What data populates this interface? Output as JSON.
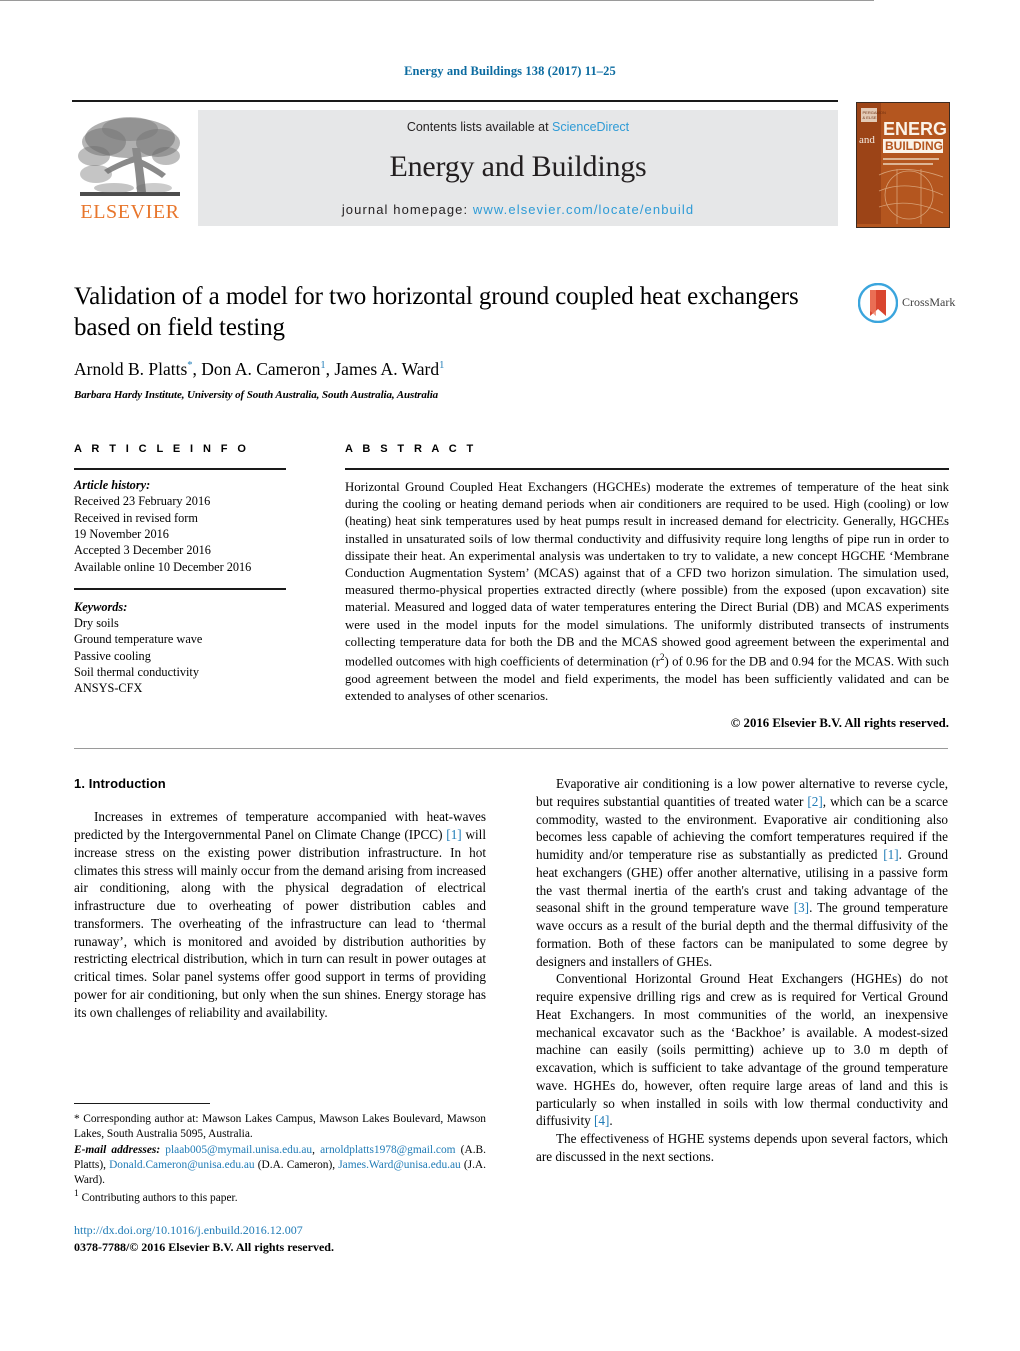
{
  "running_head": "Energy and Buildings 138 (2017) 11–25",
  "masthead": {
    "contents_prefix": "Contents lists available at ",
    "sciencedirect": "ScienceDirect",
    "journal_title": "Energy and Buildings",
    "homepage_prefix": "journal homepage: ",
    "homepage_url": "www.elsevier.com/locate/enbuild",
    "publisher": "ELSEVIER",
    "cover_and": "and",
    "cover_energy": "ENERGY",
    "cover_buildings": "BUILDINGS",
    "link_color": "#2e9bd6",
    "band_color": "#e6e7e8"
  },
  "crossmark": {
    "label": "CrossMark"
  },
  "title": "Validation of a model for two horizontal ground coupled heat exchangers based on field testing",
  "authors_html": "Arnold B. Platts<sup>*</sup>, Don A. Cameron<sup>1</sup>, James A. Ward<sup>1</sup>",
  "affiliation": "Barbara Hardy Institute, University of South Australia, South Australia, Australia",
  "article_info": {
    "heading": "A R T I C L E   I N F O",
    "history_label": "Article history:",
    "history": [
      "Received 23 February 2016",
      "Received in revised form",
      "19 November 2016",
      "Accepted 3 December 2016",
      "Available online 10 December 2016"
    ],
    "keywords_label": "Keywords:",
    "keywords": [
      "Dry soils",
      "Ground temperature wave",
      "Passive cooling",
      "Soil thermal conductivity",
      "ANSYS-CFX"
    ]
  },
  "abstract": {
    "heading": "A B S T R A C T",
    "text_html": "Horizontal Ground Coupled Heat Exchangers (HGCHEs) moderate the extremes of temperature of the heat sink during the cooling or heating demand periods when air conditioners are required to be used. High (cooling) or low (heating) heat sink temperatures used by heat pumps result in increased demand for electricity. Generally, HGCHEs installed in unsaturated soils of low thermal conductivity and diffusivity require long lengths of pipe run in order to dissipate their heat. An experimental analysis was undertaken to try to validate, a new concept HGCHE ‘Membrane Conduction Augmentation System’ (MCAS) against that of a CFD two horizon simulation. The simulation used, measured thermo-physical properties extracted directly (where possible) from the exposed (upon excavation) site material. Measured and logged data of water temperatures entering the Direct Burial (DB) and MCAS experiments were used in the model inputs for the model simulations. The uniformly distributed transects of instruments collecting temperature data for both the DB and the MCAS showed good agreement between the experimental and modelled outcomes with high coefficients of determination (r<sup>2</sup>) of 0.96 for the DB and 0.94 for the MCAS. With such good agreement between the model and field experiments, the model has been sufficiently validated and can be extended to analyses of other scenarios.",
    "copyright": "© 2016 Elsevier B.V. All rights reserved."
  },
  "body": {
    "section_number_title": "1.  Introduction",
    "left_paragraphs_html": [
      "Increases in extremes of temperature accompanied with heat-waves predicted by the Intergovernmental Panel on Climate Change (IPCC) <span class=\"ref\">[1]</span> will increase stress on the existing power distribution infrastructure. In hot climates this stress will mainly occur from the demand arising from increased air conditioning, along with the physical degradation of electrical infrastructure due to overheating of power distribution cables and transformers. The overheating of the infrastructure can lead to ‘thermal runaway’, which is monitored and avoided by distribution authorities by restricting electrical distribution, which in turn can result in power outages at critical times. Solar panel systems offer good support in terms of providing power for air conditioning, but only when the sun shines. Energy storage has its own challenges of reliability and availability."
    ],
    "right_paragraphs_html": [
      "Evaporative air conditioning is a low power alternative to reverse cycle, but requires substantial quantities of treated water <span class=\"ref\">[2]</span>, which can be a scarce commodity, wasted to the environment. Evaporative air conditioning also becomes less capable of achieving the comfort temperatures required if the humidity and/or temperature rise as substantially as predicted <span class=\"ref\">[1]</span>. Ground heat exchangers (GHE) offer another alternative, utilising in a passive form the vast thermal inertia of the earth's crust and taking advantage of the seasonal shift in the ground temperature wave <span class=\"ref\">[3]</span>. The ground temperature wave occurs as a result of the burial depth and the thermal diffusivity of the formation. Both of these factors can be manipulated to some degree by designers and installers of GHEs.",
      "Conventional Horizontal Ground Heat Exchangers (HGHEs) do not require expensive drilling rigs and crew as is required for Vertical Ground Heat Exchangers. In most communities of the world, an inexpensive mechanical excavator such as the ‘Backhoe’ is available. A modest-sized machine can easily (soils permitting) achieve up to 3.0 m depth of excavation, which is sufficient to take advantage of the ground temperature wave. HGHEs do, however, often require large areas of land and this is particularly so when installed in soils with low thermal conductivity and diffusivity <span class=\"ref\">[4]</span>.",
      "The effectiveness of HGHE systems depends upon several factors, which are discussed in the next sections."
    ]
  },
  "footnotes": {
    "corresponding_html": "<span>*</span>  Corresponding author at: Mawson Lakes Campus, Mawson Lakes Boulevard, Mawson Lakes, South Australia 5095, Australia.",
    "emails_html": "<span class=\"ital\">E-mail addresses:</span> <span class=\"link\">plaab005@mymail.unisa.edu.au</span>, <span class=\"link\">arnoldplatts1978@gmail.com</span> (A.B. Platts), <span class=\"link\">Donald.Cameron@unisa.edu.au</span> (D.A. Cameron), <span class=\"link\">James.Ward@unisa.edu.au</span> (J.A. Ward).",
    "contributing_html": "<sup>1</sup>  Contributing authors to this paper."
  },
  "doi_block": {
    "doi": "http://dx.doi.org/10.1016/j.enbuild.2016.12.007",
    "issn_line": "0378-7788/© 2016 Elsevier B.V. All rights reserved."
  }
}
